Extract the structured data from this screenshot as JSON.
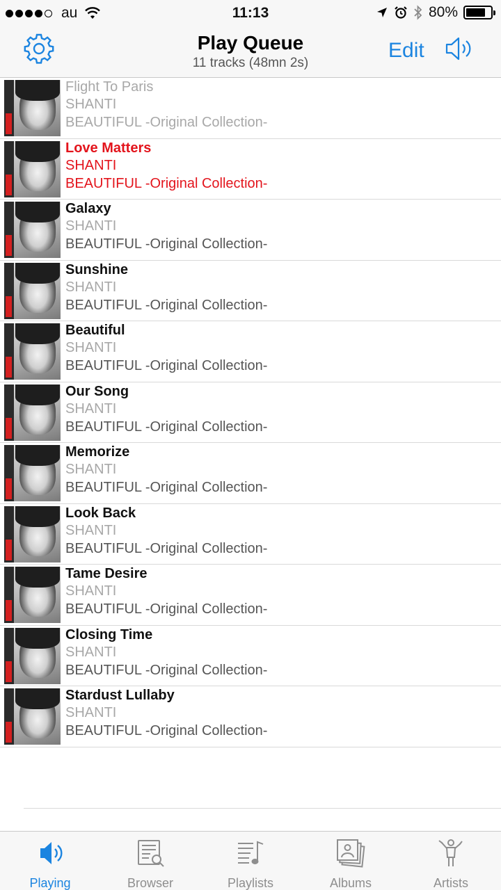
{
  "status_bar": {
    "carrier": "au",
    "time": "11:13",
    "battery_text": "80%",
    "battery_level": 0.8,
    "icons": [
      "signal-dots",
      "wifi-icon",
      "location-icon",
      "alarm-icon",
      "bluetooth-icon",
      "battery-icon"
    ]
  },
  "nav": {
    "title": "Play Queue",
    "subtitle": "11 tracks (48mn 2s)",
    "edit_label": "Edit",
    "left_icon": "gear-icon",
    "right_icon": "speaker-icon",
    "accent_color": "#1b84e0"
  },
  "tracks": [
    {
      "title": "Flight To Paris",
      "artist": "SHANTI",
      "album": "BEAUTIFUL -Original Collection-",
      "state": "played"
    },
    {
      "title": "Love Matters",
      "artist": "SHANTI",
      "album": "BEAUTIFUL -Original Collection-",
      "state": "current"
    },
    {
      "title": "Galaxy",
      "artist": "SHANTI",
      "album": "BEAUTIFUL -Original Collection-",
      "state": "upcoming"
    },
    {
      "title": "Sunshine",
      "artist": "SHANTI",
      "album": "BEAUTIFUL -Original Collection-",
      "state": "upcoming"
    },
    {
      "title": "Beautiful",
      "artist": "SHANTI",
      "album": "BEAUTIFUL -Original Collection-",
      "state": "upcoming"
    },
    {
      "title": "Our Song",
      "artist": "SHANTI",
      "album": "BEAUTIFUL -Original Collection-",
      "state": "upcoming"
    },
    {
      "title": "Memorize",
      "artist": "SHANTI",
      "album": "BEAUTIFUL -Original Collection-",
      "state": "upcoming"
    },
    {
      "title": "Look Back",
      "artist": "SHANTI",
      "album": "BEAUTIFUL -Original Collection-",
      "state": "upcoming"
    },
    {
      "title": "Tame Desire",
      "artist": "SHANTI",
      "album": "BEAUTIFUL -Original Collection-",
      "state": "upcoming"
    },
    {
      "title": "Closing Time",
      "artist": "SHANTI",
      "album": "BEAUTIFUL -Original Collection-",
      "state": "upcoming"
    },
    {
      "title": "Stardust Lullaby",
      "artist": "SHANTI",
      "album": "BEAUTIFUL -Original Collection-",
      "state": "upcoming"
    }
  ],
  "current_track_color": "#e3141c",
  "tabs": [
    {
      "label": "Playing",
      "icon": "speaker-icon",
      "active": true
    },
    {
      "label": "Browser",
      "icon": "browser-icon",
      "active": false
    },
    {
      "label": "Playlists",
      "icon": "playlist-icon",
      "active": false
    },
    {
      "label": "Albums",
      "icon": "albums-icon",
      "active": false
    },
    {
      "label": "Artists",
      "icon": "artist-icon",
      "active": false
    }
  ]
}
